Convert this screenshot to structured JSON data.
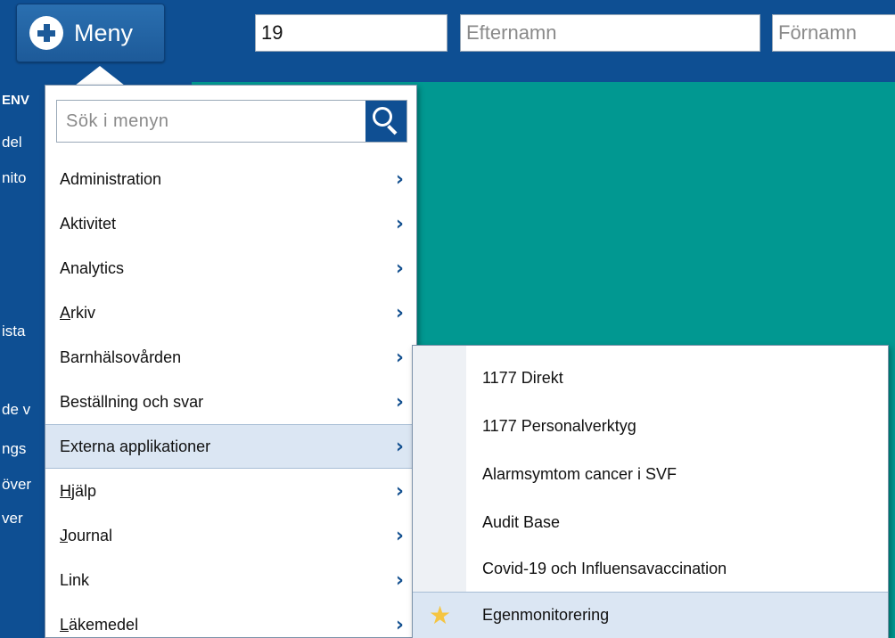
{
  "header": {
    "menu_label": "Meny",
    "patient_id_value": "19",
    "lastname_placeholder": "Efternamn",
    "firstname_placeholder": "Förnamn"
  },
  "left_panel": {
    "labels": [
      "ENV",
      "del",
      "nito",
      "ista",
      "de v",
      "ngs",
      "över",
      "ver"
    ]
  },
  "menu": {
    "search_placeholder": "Sök i menyn",
    "items": [
      {
        "label": "Administration"
      },
      {
        "label": "Aktivitet"
      },
      {
        "label": "Analytics"
      },
      {
        "label": "Arkiv",
        "mnemonic": "A"
      },
      {
        "label": "Barnhälsovården"
      },
      {
        "label": "Beställning och svar"
      },
      {
        "label": "Externa applikationer",
        "active": true
      },
      {
        "label": "Hjälp",
        "mnemonic": "H"
      },
      {
        "label": "Journal",
        "mnemonic": "J"
      },
      {
        "label": "Link"
      },
      {
        "label": "Läkemedel",
        "mnemonic": "L"
      }
    ],
    "chevron": "›"
  },
  "submenu": {
    "items": [
      {
        "label": "1177 Direkt"
      },
      {
        "label": "1177 Personalverktyg"
      },
      {
        "label": "Alarmsymtom cancer i SVF"
      },
      {
        "label": "Audit Base"
      },
      {
        "label": "Covid-19 och Influensavaccination"
      },
      {
        "label": "Egenmonitorering",
        "active": true,
        "icon": "star-icon"
      }
    ]
  },
  "colors": {
    "topbar": "#0e4f93",
    "content": "#019891",
    "highlight": "#dbe6f3",
    "star": "#f5c542"
  }
}
